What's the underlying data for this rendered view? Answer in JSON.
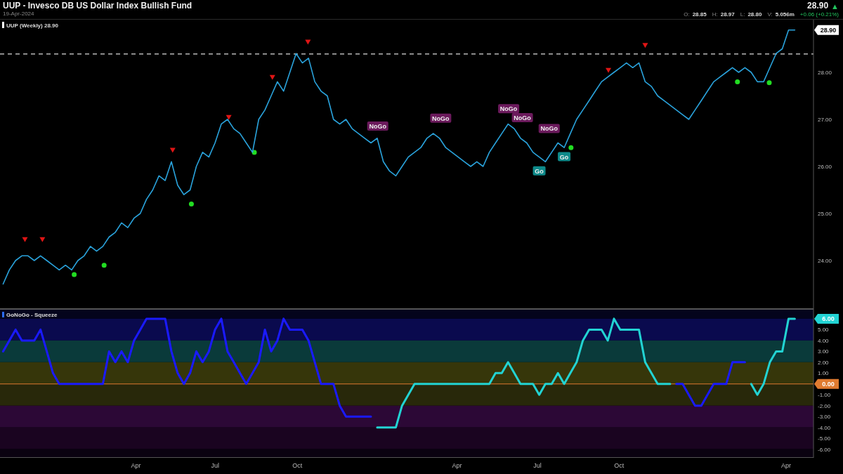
{
  "header": {
    "title": "UUP - Invesco DB US Dollar Index Bullish Fund",
    "date": "19-Apr-2024",
    "last_price": "28.90",
    "change_icon": "▲",
    "ohlc": [
      {
        "label": "O:",
        "value": "28.85"
      },
      {
        "label": "H:",
        "value": "28.97"
      },
      {
        "label": "L:",
        "value": "28.80"
      },
      {
        "label": "V:",
        "value": "5.056m"
      }
    ],
    "change": "+0.06 (+0.21%)"
  },
  "price_panel": {
    "legend": "UUP (Weekly) 28.90",
    "chart_data": {
      "type": "line",
      "ylim": [
        22.97,
        29.12
      ],
      "yticks": [
        {
          "value": 24,
          "label": "24.00"
        },
        {
          "value": 25,
          "label": "25.00"
        },
        {
          "value": 26,
          "label": "26.00"
        },
        {
          "value": 27,
          "label": "27.00"
        },
        {
          "value": 28,
          "label": "28.00"
        }
      ],
      "series": [
        {
          "color": "#2aa3dc",
          "values": [
            23.5,
            23.8,
            24.0,
            24.1,
            24.1,
            24.0,
            24.1,
            24.0,
            23.9,
            23.8,
            23.9,
            23.8,
            24.0,
            24.1,
            24.3,
            24.2,
            24.3,
            24.5,
            24.6,
            24.8,
            24.7,
            24.9,
            25.0,
            25.3,
            25.5,
            25.8,
            25.7,
            26.1,
            25.6,
            25.4,
            25.5,
            26.0,
            26.3,
            26.2,
            26.5,
            26.9,
            27.0,
            26.8,
            26.7,
            26.5,
            26.3,
            27.0,
            27.2,
            27.5,
            27.8,
            27.6,
            28.0,
            28.4,
            28.2,
            28.3,
            27.8,
            27.6,
            27.5,
            27.0,
            26.9,
            27.0,
            26.8,
            26.7,
            26.6,
            26.5,
            26.6,
            26.1,
            25.9,
            25.8,
            26.0,
            26.2,
            26.3,
            26.4,
            26.6,
            26.7,
            26.6,
            26.4,
            26.3,
            26.2,
            26.1,
            26.0,
            26.1,
            26.0,
            26.3,
            26.5,
            26.7,
            26.9,
            26.8,
            26.6,
            26.5,
            26.3,
            26.2,
            26.1,
            26.3,
            26.5,
            26.4,
            26.7,
            27.0,
            27.2,
            27.4,
            27.6,
            27.8,
            27.9,
            28.0,
            28.1,
            28.2,
            28.1,
            28.2,
            27.8,
            27.7,
            27.5,
            27.4,
            27.3,
            27.2,
            27.1,
            27.0,
            27.2,
            27.4,
            27.6,
            27.8,
            27.9,
            28.0,
            28.1,
            28.0,
            28.1,
            28.0,
            27.8,
            27.8,
            28.1,
            28.4,
            28.5,
            28.9,
            28.9
          ]
        }
      ],
      "annotations": [
        "NoGo",
        "NoGo",
        "NoGo",
        "NoGo",
        "NoGo",
        "Go",
        "Go",
        "28.90"
      ]
    }
  },
  "oscillator_panel": {
    "legend": "GoNoGo - Squeeze",
    "x_axis_labels": [
      "Apr",
      "Jul",
      "Oct",
      "Apr",
      "Jul",
      "Oct",
      "Apr"
    ],
    "chart_data": {
      "type": "line",
      "ylim": [
        -6.8,
        6.9
      ],
      "yticks": [
        {
          "value": 5,
          "label": "5.00"
        },
        {
          "value": 4,
          "label": "4.00"
        },
        {
          "value": 3,
          "label": "3.00"
        },
        {
          "value": 2,
          "label": "2.00"
        },
        {
          "value": 1,
          "label": "1.00"
        },
        {
          "value": -1,
          "label": "-1.00"
        },
        {
          "value": -2,
          "label": "-2.00"
        },
        {
          "value": -3,
          "label": "-3.00"
        },
        {
          "value": -4,
          "label": "-4.00"
        },
        {
          "value": -5,
          "label": "-5.00"
        },
        {
          "value": -6,
          "label": "-6.00"
        }
      ],
      "series": [
        {
          "color": "#1a1aff",
          "values": [
            3,
            4,
            5,
            4,
            4,
            4,
            5,
            3,
            1,
            0,
            0,
            0,
            0,
            0,
            0,
            0,
            0,
            3,
            2,
            3,
            2,
            4,
            5,
            6,
            6,
            6,
            6,
            3,
            1,
            0,
            1,
            3,
            2,
            3,
            5,
            6,
            3,
            2,
            1,
            0,
            1,
            2,
            5,
            3,
            4,
            6,
            5,
            5,
            5,
            4,
            2,
            0,
            0,
            0,
            -2,
            -3,
            -3,
            -3,
            -3,
            -3,
            null,
            null,
            null,
            null,
            null,
            null,
            null,
            null,
            null,
            null,
            null,
            null,
            null,
            null,
            null,
            null,
            null,
            null,
            null,
            null,
            null,
            null,
            null,
            null,
            null,
            null,
            null,
            null,
            null,
            null,
            null,
            null,
            null,
            null,
            null,
            null,
            null,
            null,
            null,
            null,
            null,
            null,
            null,
            null,
            null,
            null,
            null,
            null,
            0,
            0,
            -1,
            -2,
            -2,
            -1,
            0,
            0,
            0,
            2,
            2,
            2,
            null,
            null,
            null,
            null,
            null,
            null,
            null,
            null
          ]
        },
        {
          "color": "#22d3d3",
          "values": [
            null,
            null,
            null,
            null,
            null,
            null,
            null,
            null,
            null,
            null,
            null,
            null,
            null,
            null,
            null,
            null,
            null,
            null,
            null,
            null,
            null,
            null,
            null,
            null,
            null,
            null,
            null,
            null,
            null,
            null,
            null,
            null,
            null,
            null,
            null,
            null,
            null,
            null,
            null,
            null,
            null,
            null,
            null,
            null,
            null,
            null,
            null,
            null,
            null,
            null,
            null,
            null,
            null,
            null,
            null,
            null,
            null,
            null,
            null,
            null,
            -4,
            -4,
            -4,
            -4,
            -2,
            -1,
            0,
            0,
            0,
            0,
            0,
            0,
            0,
            0,
            0,
            0,
            0,
            0,
            0,
            1,
            1,
            2,
            1,
            0,
            0,
            0,
            -1,
            0,
            0,
            1,
            0,
            1,
            2,
            4,
            5,
            5,
            5,
            4,
            6,
            5,
            5,
            5,
            5,
            2,
            1,
            0,
            0,
            0,
            null,
            null,
            null,
            null,
            null,
            null,
            null,
            null,
            null,
            null,
            null,
            null,
            0,
            -1,
            0,
            2,
            3,
            3,
            6,
            6
          ]
        }
      ],
      "annotations": [
        "6.00",
        "0.00"
      ]
    }
  }
}
